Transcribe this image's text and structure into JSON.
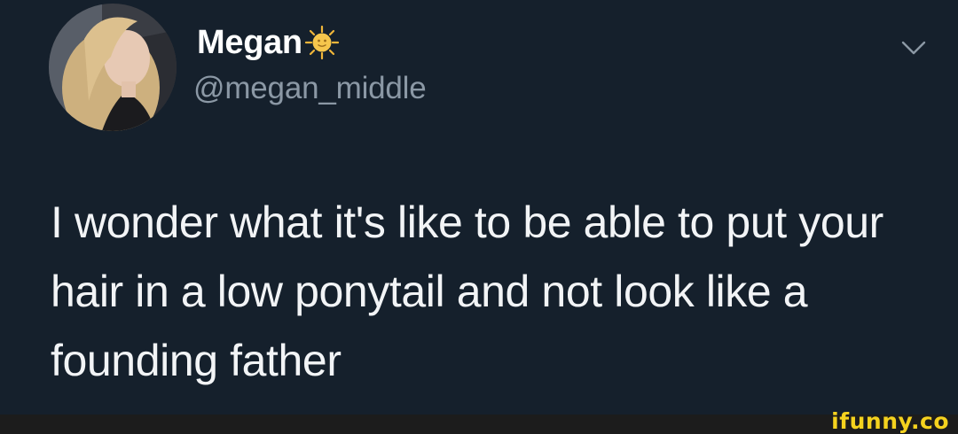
{
  "tweet": {
    "display_name": "Megan",
    "handle": "@megan_middle",
    "text": "I wonder what it's like to be able to put your hair in a low ponytail and not look like a founding father"
  },
  "icons": {
    "name_emoji": "sun-icon",
    "menu": "chevron-down-icon"
  },
  "watermark": {
    "text": "ifunny.co"
  },
  "colors": {
    "background": "#15202c",
    "handle": "#8b98a5",
    "watermark": "#f5d21e"
  }
}
